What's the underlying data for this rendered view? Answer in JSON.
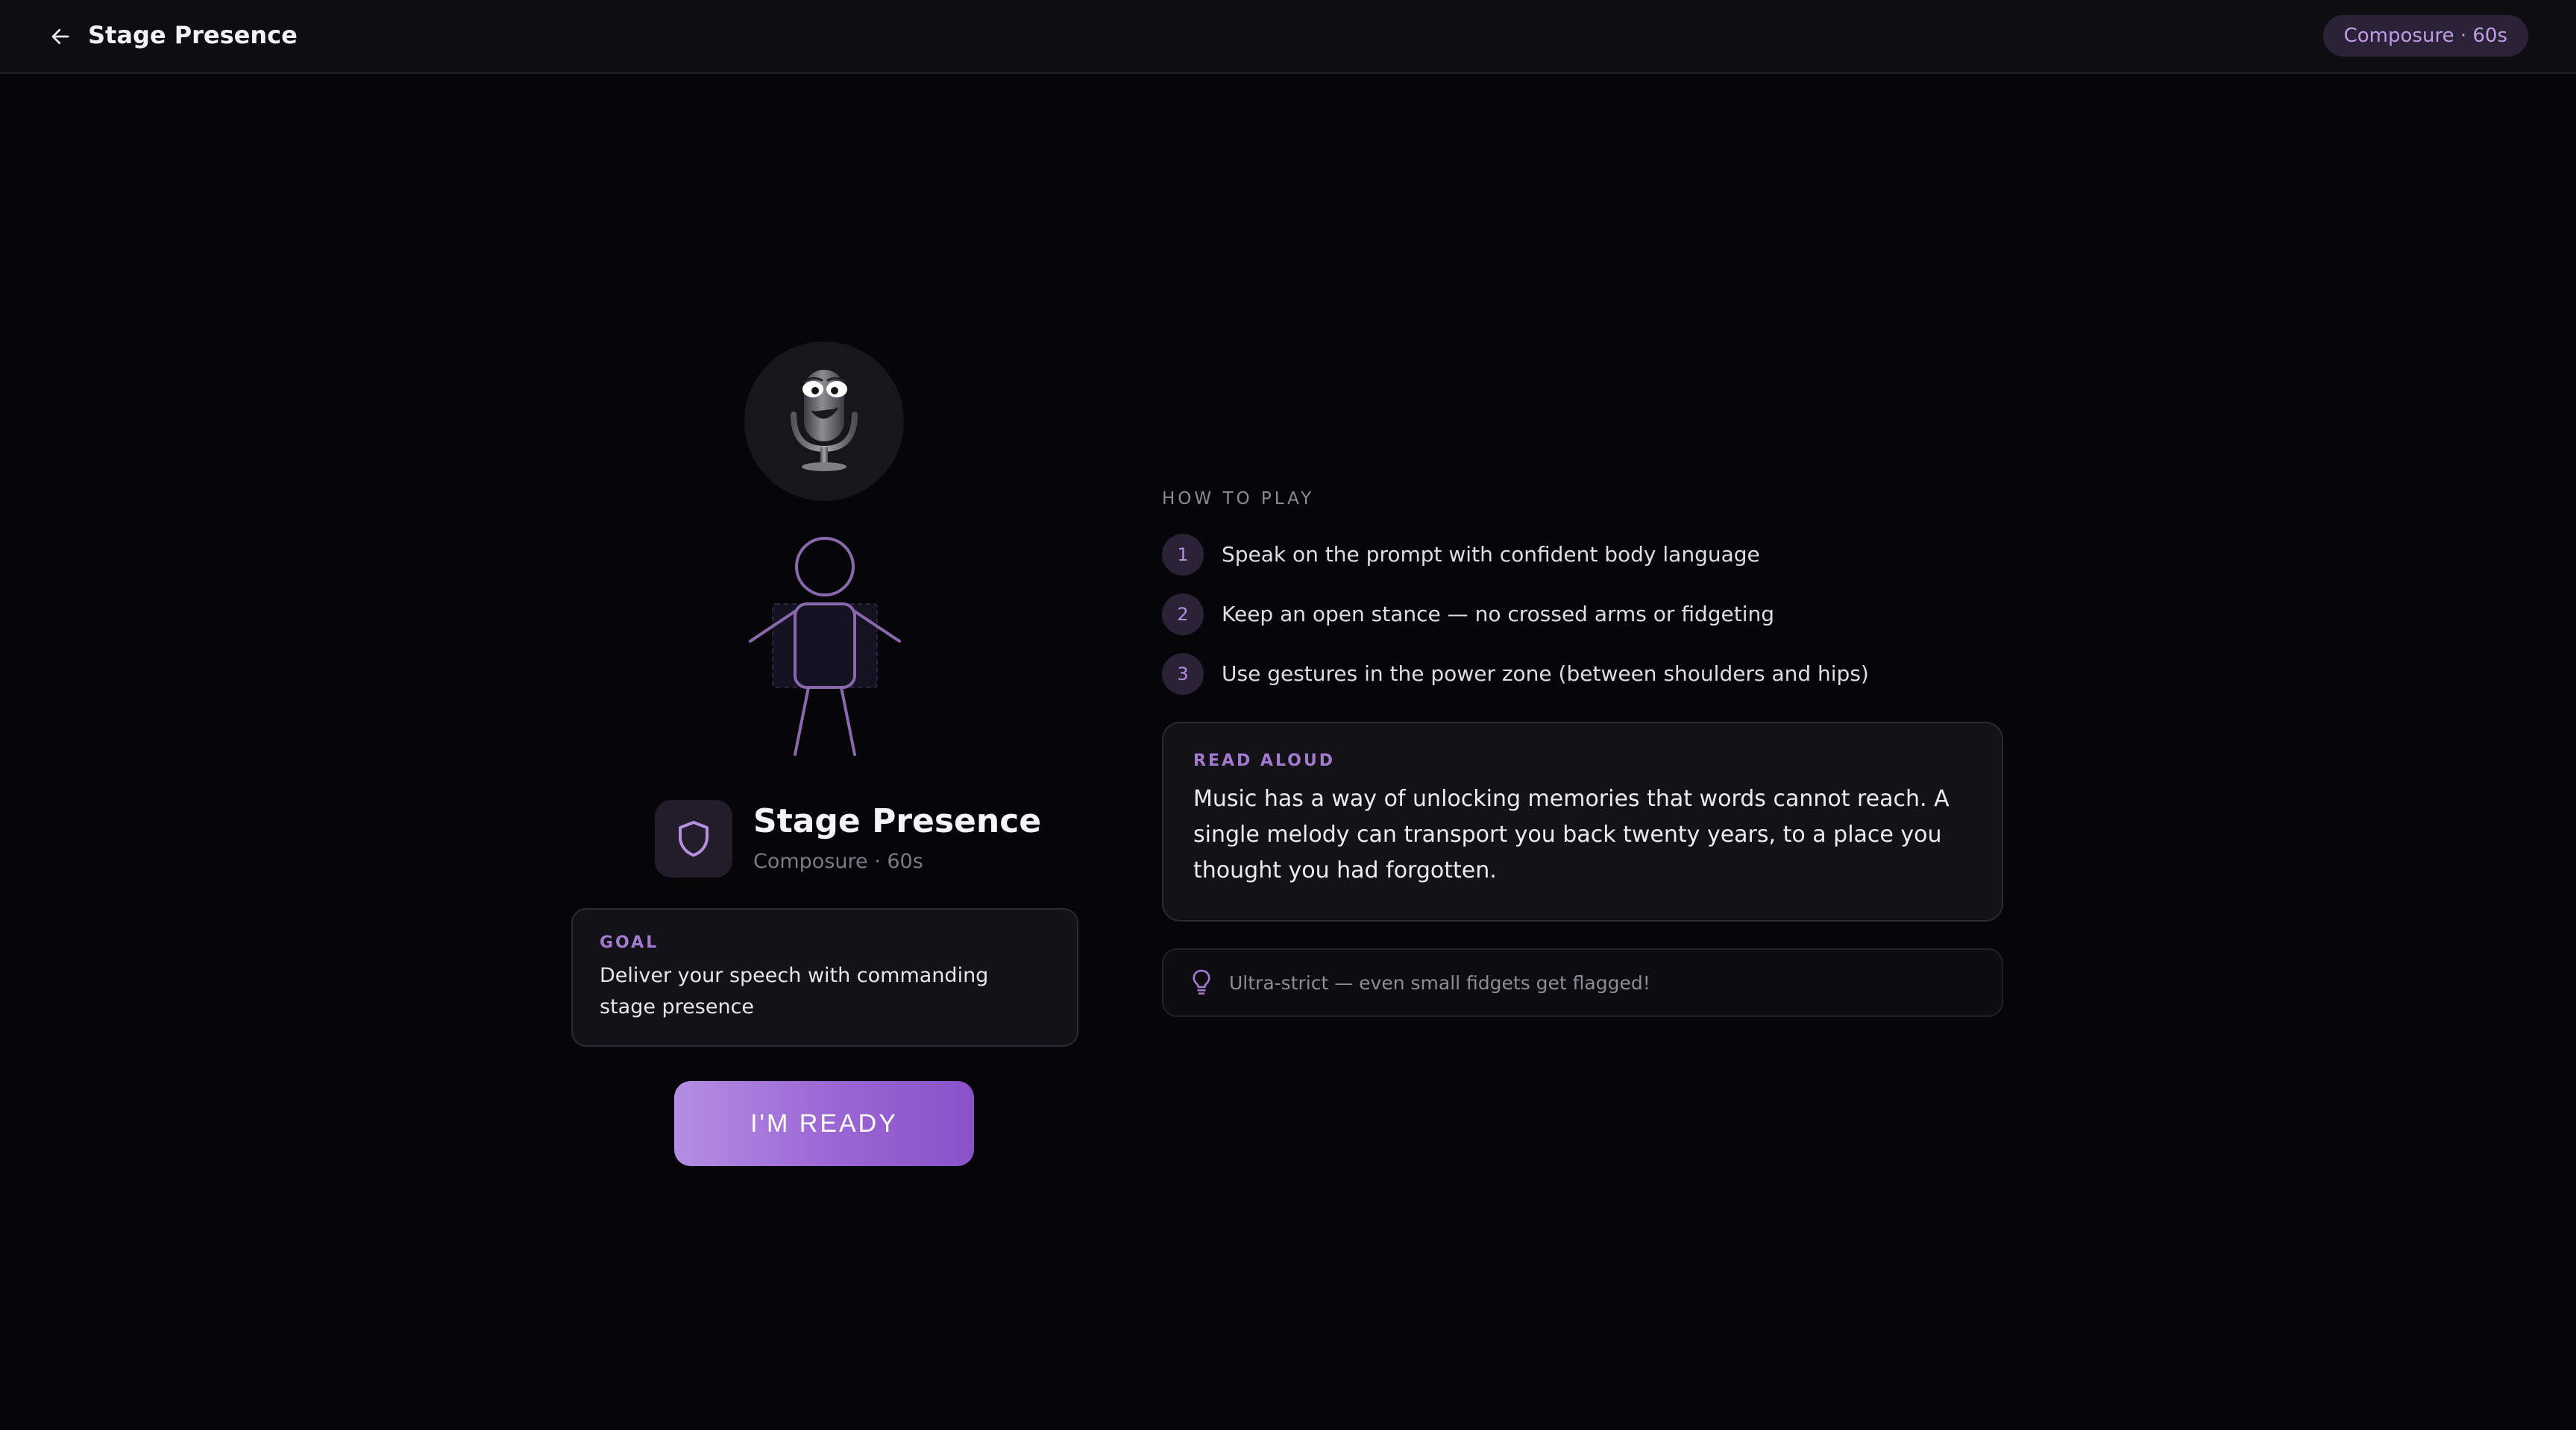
{
  "header": {
    "title": "Stage Presence",
    "badge": "Composure · 60s",
    "back_icon": "arrow-left-icon"
  },
  "game": {
    "title": "Stage Presence",
    "subtitle": "Composure · 60s",
    "mascot_icon": "microphone-mascot-icon",
    "category_icon": "shield-icon"
  },
  "goal": {
    "label": "GOAL",
    "text": "Deliver your speech with commanding stage presence"
  },
  "ready_button": {
    "label": "I'M READY"
  },
  "how_to_play": {
    "label": "HOW TO PLAY",
    "steps": [
      {
        "number": "1",
        "text": "Speak on the prompt with confident body language"
      },
      {
        "number": "2",
        "text": "Keep an open stance — no crossed arms or fidgeting"
      },
      {
        "number": "3",
        "text": "Use gestures in the power zone (between shoulders and hips)"
      }
    ]
  },
  "read_aloud": {
    "label": "READ ALOUD",
    "text": "Music has a way of unlocking memories that words cannot reach. A single melody can transport you back twenty years, to a place you thought you had forgotten."
  },
  "tip": {
    "icon": "lightbulb-icon",
    "text": "Ultra-strict — even small fidgets get flagged!"
  },
  "colors": {
    "accent": "#a47ad0",
    "background": "#060609",
    "button_gradient_start": "#b48ee3",
    "button_gradient_end": "#8a52c8"
  }
}
